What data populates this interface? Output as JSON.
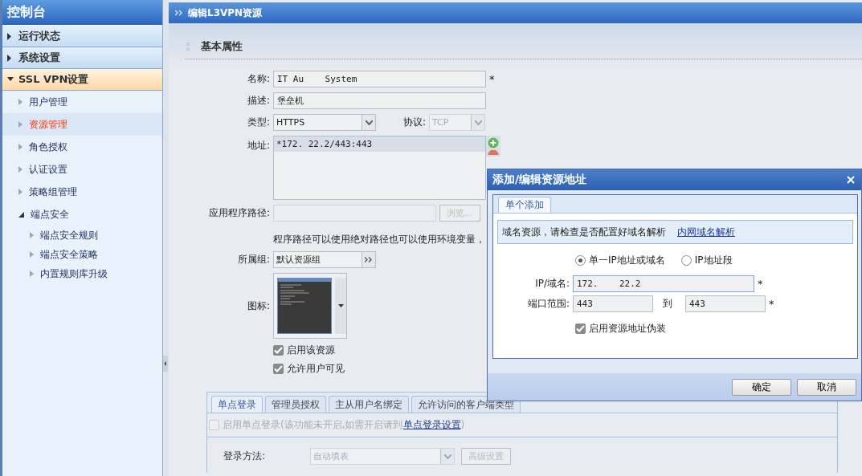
{
  "sidebar": {
    "title": "控制台",
    "sections": [
      {
        "label": "运行状态",
        "expanded": false
      },
      {
        "label": "系统设置",
        "expanded": false
      },
      {
        "label": "SSL VPN设置",
        "expanded": true,
        "items": [
          {
            "label": "用户管理",
            "selected": false,
            "expanded": false
          },
          {
            "label": "资源管理",
            "selected": true,
            "expanded": false
          },
          {
            "label": "角色授权",
            "selected": false,
            "expanded": false
          },
          {
            "label": "认证设置",
            "selected": false,
            "expanded": false
          },
          {
            "label": "策略组管理",
            "selected": false,
            "expanded": false
          },
          {
            "label": "端点安全",
            "selected": false,
            "expanded": true,
            "children": [
              {
                "label": "端点安全规则",
                "selected": false
              },
              {
                "label": "端点安全策略",
                "selected": false
              },
              {
                "label": "内置规则库升级",
                "selected": false
              }
            ]
          }
        ]
      }
    ]
  },
  "page_title": "编辑L3VPN资源",
  "section_title": "基本属性",
  "form": {
    "name": {
      "label": "名称:",
      "value": "IT Au    System",
      "required_mark": "*"
    },
    "description": {
      "label": "描述:",
      "value": "堡垒机"
    },
    "type": {
      "label": "类型:",
      "value": "HTTPS"
    },
    "protocol": {
      "label": "协议:",
      "value": "TCP",
      "disabled": true
    },
    "address": {
      "label": "地址:",
      "entries": [
        {
          "text": "*172.    22.2/443:443",
          "selected": true
        }
      ]
    },
    "app_path": {
      "label": "应用程序路径:",
      "browse": "浏览...",
      "disabled": true
    },
    "hint": "程序路径可以使用绝对路径也可以使用环境变量，",
    "group": {
      "label": "所属组:",
      "value": "默认资源组"
    },
    "icon": {
      "label": "图标:"
    },
    "checkboxes": [
      {
        "label": "启用该资源",
        "checked": true
      },
      {
        "label": "允许用户可见",
        "checked": true
      }
    ]
  },
  "lower_tabs": [
    {
      "label": "单点登录",
      "selected": true
    },
    {
      "label": "管理员授权",
      "selected": false
    },
    {
      "label": "主从用户名绑定",
      "selected": false
    },
    {
      "label": "允许访问的客户端类型",
      "selected": false
    }
  ],
  "sso": {
    "label": "启用单点登录(该功能未开启,如需开启请到",
    "link": "单点登录设置",
    "suffix": ")",
    "checked": false,
    "disabled": true,
    "login_method": {
      "label": "登录方法:",
      "value": "自动填表",
      "advanced": "高级设置"
    }
  },
  "dialog": {
    "title": "添加/编辑资源地址",
    "tabs": [
      {
        "label": "单个添加",
        "selected": true
      }
    ],
    "notice": "域名资源，请检查是否配置好域名解析",
    "notice_link": "内网域名解析",
    "radios": [
      {
        "label": "单一IP地址或域名",
        "selected": true
      },
      {
        "label": "IP地址段",
        "selected": false
      }
    ],
    "ip": {
      "label": "IP/域名:",
      "value": "172.    22.2",
      "required_mark": "*"
    },
    "port": {
      "label": "端口范围:",
      "from": "443",
      "to_label": "到",
      "to": "443",
      "required_mark": "*"
    },
    "checkbox": {
      "label": "启用资源地址伪装",
      "checked": true
    },
    "buttons": [
      "确定",
      "取消"
    ]
  }
}
